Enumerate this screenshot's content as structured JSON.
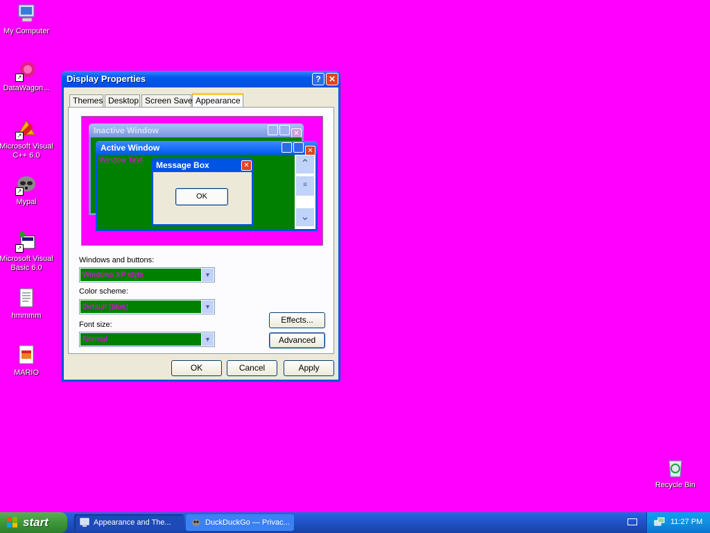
{
  "desktop": {
    "icons": [
      {
        "label": "My Computer"
      },
      {
        "label": "DataWagon..."
      },
      {
        "label": "Microsoft Visual C++ 6.0"
      },
      {
        "label": "Mypal"
      },
      {
        "label": "Microsoft Visual Basic 6.0"
      },
      {
        "label": "hmmmm"
      },
      {
        "label": "MARIO"
      },
      {
        "label": "Recycle Bin"
      }
    ]
  },
  "dialog": {
    "title": "Display Properties",
    "help_glyph": "?",
    "close_glyph": "✕",
    "tabs": [
      {
        "label": "Themes"
      },
      {
        "label": "Desktop"
      },
      {
        "label": "Screen Saver"
      },
      {
        "label": "Appearance"
      }
    ],
    "preview": {
      "inactive_title": "Inactive Window",
      "active_title": "Active Window",
      "window_text": "Window Text",
      "msgbox_title": "Message Box",
      "msgbox_ok": "OK"
    },
    "windows_buttons": {
      "label": "Windows and buttons:",
      "value": "Windows XP style"
    },
    "color_scheme": {
      "label": "Color scheme:",
      "value": "Default (blue)"
    },
    "font_size": {
      "label": "Font size:",
      "value": "Normal"
    },
    "effects_button": "Effects...",
    "advanced_button": "Advanced",
    "ok_button": "OK",
    "cancel_button": "Cancel",
    "apply_button": "Apply"
  },
  "taskbar": {
    "start_label": "start",
    "tasks": [
      {
        "label": "Appearance and The..."
      },
      {
        "label": "DuckDuckGo — Privac..."
      }
    ],
    "clock": "11:27 PM"
  },
  "colors": {
    "desktop": "#ff00ff",
    "window_bg": "#008000",
    "window_text": "#ff00ff"
  }
}
